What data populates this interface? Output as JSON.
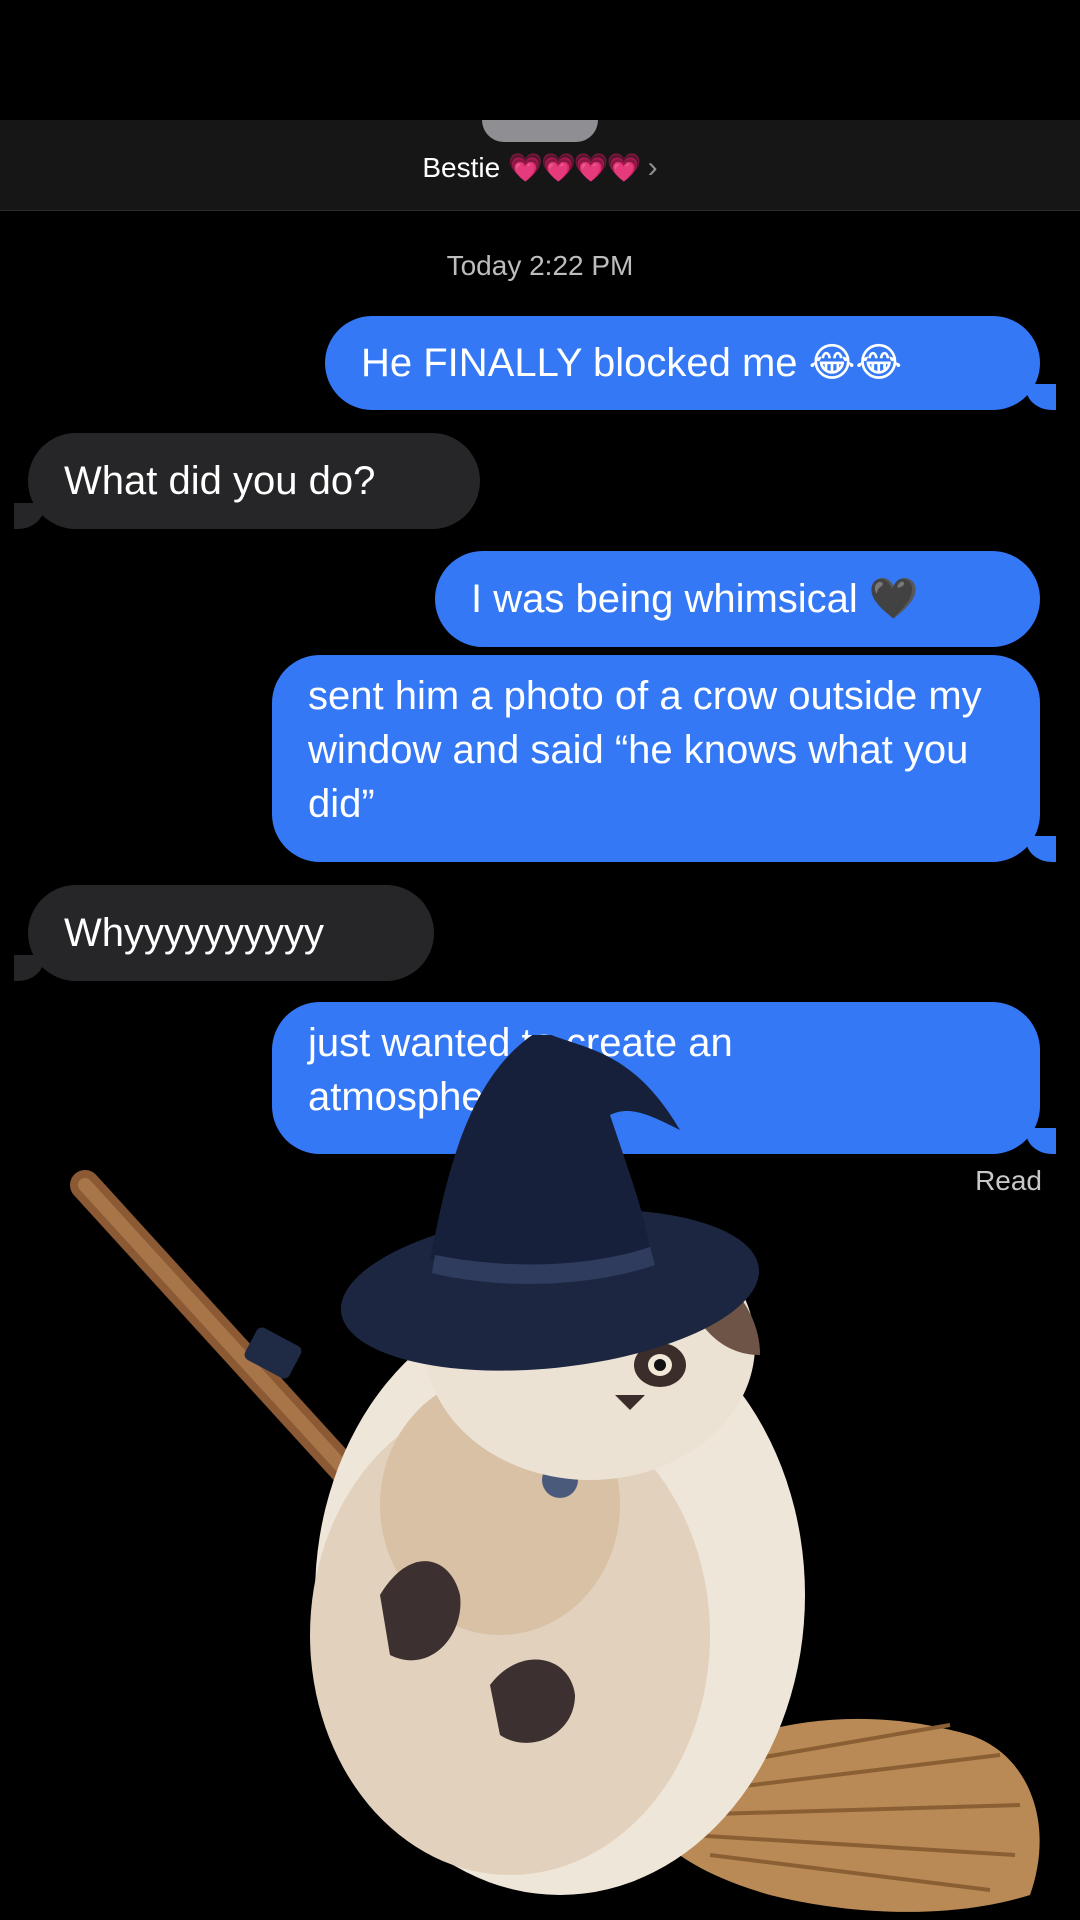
{
  "contact": {
    "name": "Bestie",
    "hearts": "💗💗💗💗",
    "chevron": "›"
  },
  "timestamp": "Today 2:22 PM",
  "messages": [
    {
      "direction": "sent",
      "text": "He FINALLY blocked me 😂😂"
    },
    {
      "direction": "received",
      "text": "What did you do?"
    },
    {
      "direction": "sent",
      "text": "I was being whimsical 🖤"
    },
    {
      "direction": "sent",
      "text": "sent him a photo of a crow outside my window and said “he knows what you did”"
    },
    {
      "direction": "received",
      "text": "Whyyyyyyyyyy"
    },
    {
      "direction": "sent",
      "text": "just wanted to create an atmosphere"
    }
  ],
  "read_receipt": "Read",
  "sticker": {
    "icon": "witch-cat-on-broom-sticker"
  },
  "colors": {
    "sent_bubble": "#3478f6",
    "received_bubble": "#262628",
    "background": "#000000"
  }
}
